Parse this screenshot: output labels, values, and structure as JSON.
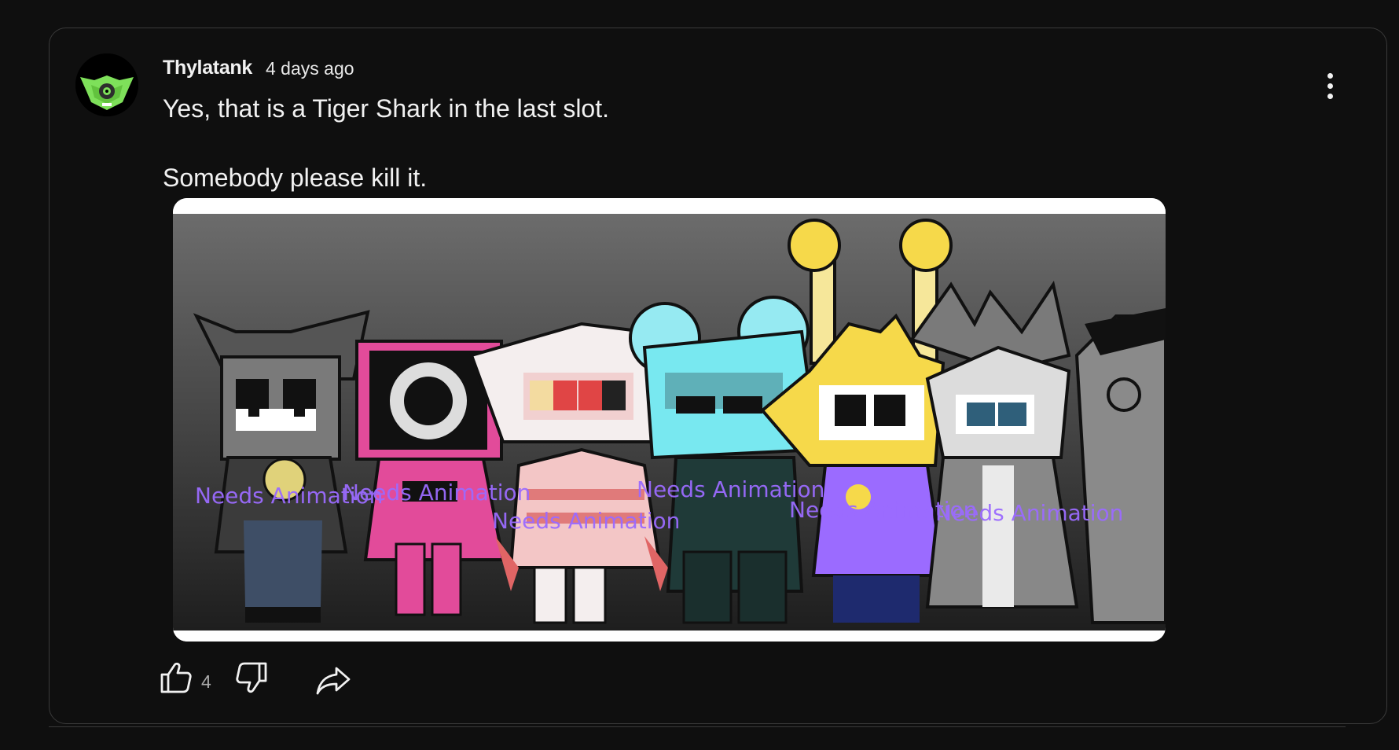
{
  "post": {
    "author": "Thylatank",
    "timestamp": "4 days ago",
    "text_line1": "Yes, that is a Tiger Shark in the last slot.",
    "text_line2": "Somebody please kill it.",
    "like_count": "4"
  },
  "image": {
    "overlay_label": "Needs Animation"
  },
  "icons": {
    "avatar": "green-creature-avatar",
    "menu": "more-vertical-icon",
    "like": "thumbs-up-icon",
    "dislike": "thumbs-down-icon",
    "share": "share-arrow-icon"
  },
  "colors": {
    "background": "#0f0f0f",
    "card_border": "#3a3a3a",
    "text": "#f1f1f1",
    "overlay_text": "#9b6bff",
    "avatar_green": "#7ee05a"
  }
}
